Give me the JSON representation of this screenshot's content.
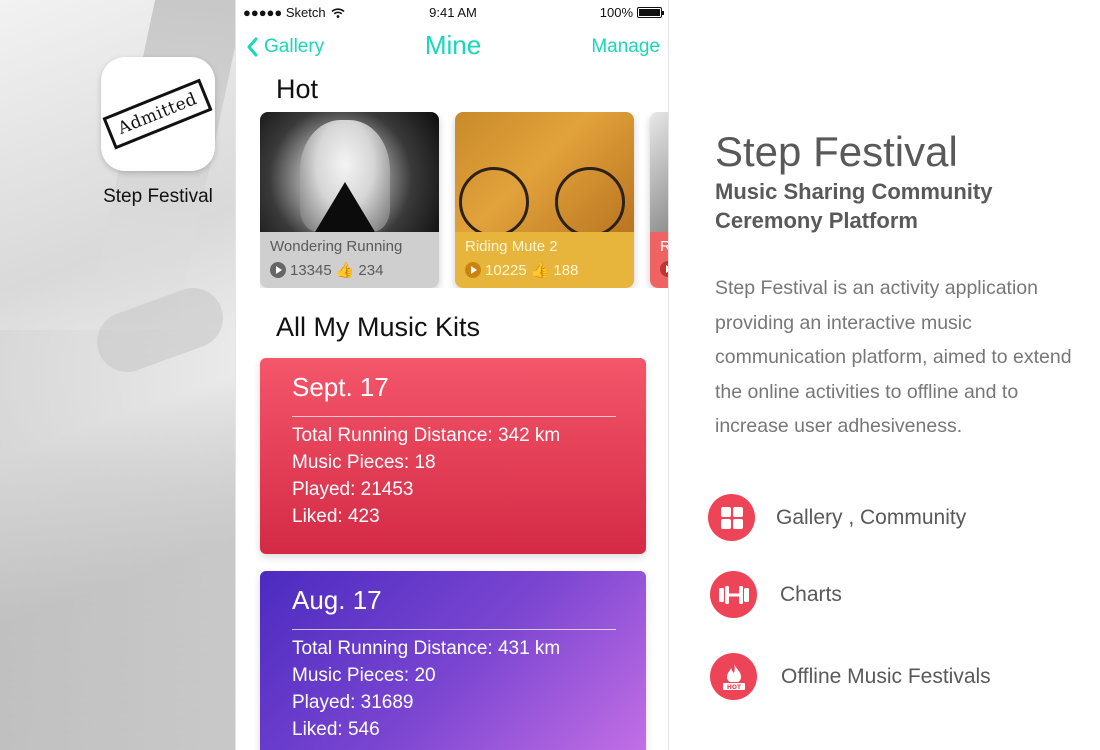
{
  "left": {
    "app_icon_text": "Admitted",
    "app_name": "Step Festival"
  },
  "status_bar": {
    "signal": "●●●●● Sketch",
    "time": "9:41 AM",
    "battery": "100%"
  },
  "nav": {
    "back_label": "Gallery",
    "title": "Mine",
    "manage_label": "Manage"
  },
  "hot": {
    "title": "Hot",
    "cards": [
      {
        "title": "Wondering Running",
        "plays": "13345",
        "likes": "234"
      },
      {
        "title": "Riding Mute 2",
        "plays": "10225",
        "likes": "188"
      },
      {
        "title": "R",
        "plays": "",
        "likes": ""
      }
    ]
  },
  "kits": {
    "title": "All My Music Kits",
    "items": [
      {
        "date": "Sept. 17",
        "distance": "Total Running Distance: 342 km",
        "pieces": "Music Pieces: 18",
        "played": "Played: 21453",
        "liked": "Liked: 423"
      },
      {
        "date": "Aug. 17",
        "distance": "Total Running Distance: 431 km",
        "pieces": "Music Pieces: 20",
        "played": "Played: 31689",
        "liked": "Liked: 546"
      }
    ]
  },
  "right": {
    "title": "Step Festival",
    "subtitle_1": "Music Sharing Community",
    "subtitle_2": "Ceremony Platform",
    "description": "Step Festival is an activity application providing an interactive music communication platform, aimed to extend the online activities to offline and to increase user adhesiveness.",
    "features": [
      {
        "icon": "grid-icon",
        "label": "Gallery , Community"
      },
      {
        "icon": "dumbbell-icon",
        "label": "Charts"
      },
      {
        "icon": "fire-hot-icon",
        "label": "Offline Music Festivals"
      }
    ],
    "accent_color": "#ee4457"
  },
  "theme": {
    "teal": "#1ad7b8"
  }
}
